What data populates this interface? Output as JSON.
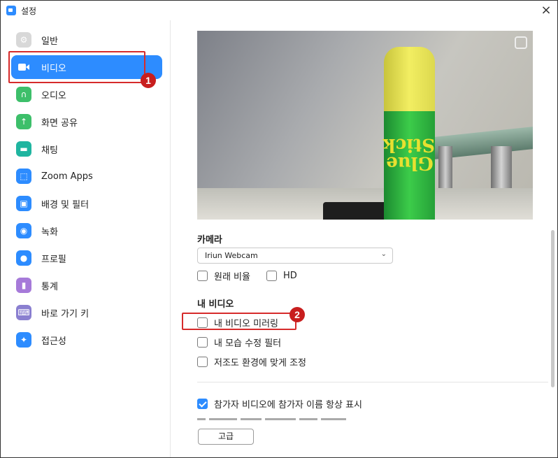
{
  "window": {
    "title": "설정",
    "close_glyph": "×"
  },
  "sidebar": {
    "items": [
      {
        "label": "일반",
        "icon": "gear-icon"
      },
      {
        "label": "비디오",
        "icon": "video-camera-icon",
        "active": true
      },
      {
        "label": "오디오",
        "icon": "headphones-icon"
      },
      {
        "label": "화면 공유",
        "icon": "share-screen-icon"
      },
      {
        "label": "채팅",
        "icon": "chat-bubble-icon"
      },
      {
        "label": "Zoom Apps",
        "icon": "apps-icon"
      },
      {
        "label": "배경 및 필터",
        "icon": "background-filter-icon"
      },
      {
        "label": "녹화",
        "icon": "record-icon"
      },
      {
        "label": "프로필",
        "icon": "profile-icon"
      },
      {
        "label": "통계",
        "icon": "statistics-icon"
      },
      {
        "label": "바로 가기 키",
        "icon": "keyboard-icon"
      },
      {
        "label": "접근성",
        "icon": "accessibility-icon"
      }
    ]
  },
  "annotations": {
    "badge1": "1",
    "badge2": "2",
    "color": "#c81e1e"
  },
  "preview": {
    "stick_text": "Glue Stick"
  },
  "camera": {
    "label": "카메라",
    "selected": "Iriun Webcam",
    "original_ratio_label": "원래 비율",
    "original_ratio_checked": false,
    "hd_label": "HD",
    "hd_checked": false
  },
  "my_video": {
    "label": "내 비디오",
    "mirror_label": "내 비디오 미러링",
    "mirror_checked": false,
    "touch_up_label": "내 모습 수정 필터",
    "touch_up_checked": false,
    "low_light_label": "저조도 환경에 맞게 조정",
    "low_light_checked": false
  },
  "participants": {
    "show_names_label": "참가자 비디오에 참가자 이름 항상 표시",
    "show_names_checked": true
  },
  "advanced_button": "고급",
  "colors": {
    "accent": "#2D8CFF",
    "highlight": "#d62b2b"
  }
}
